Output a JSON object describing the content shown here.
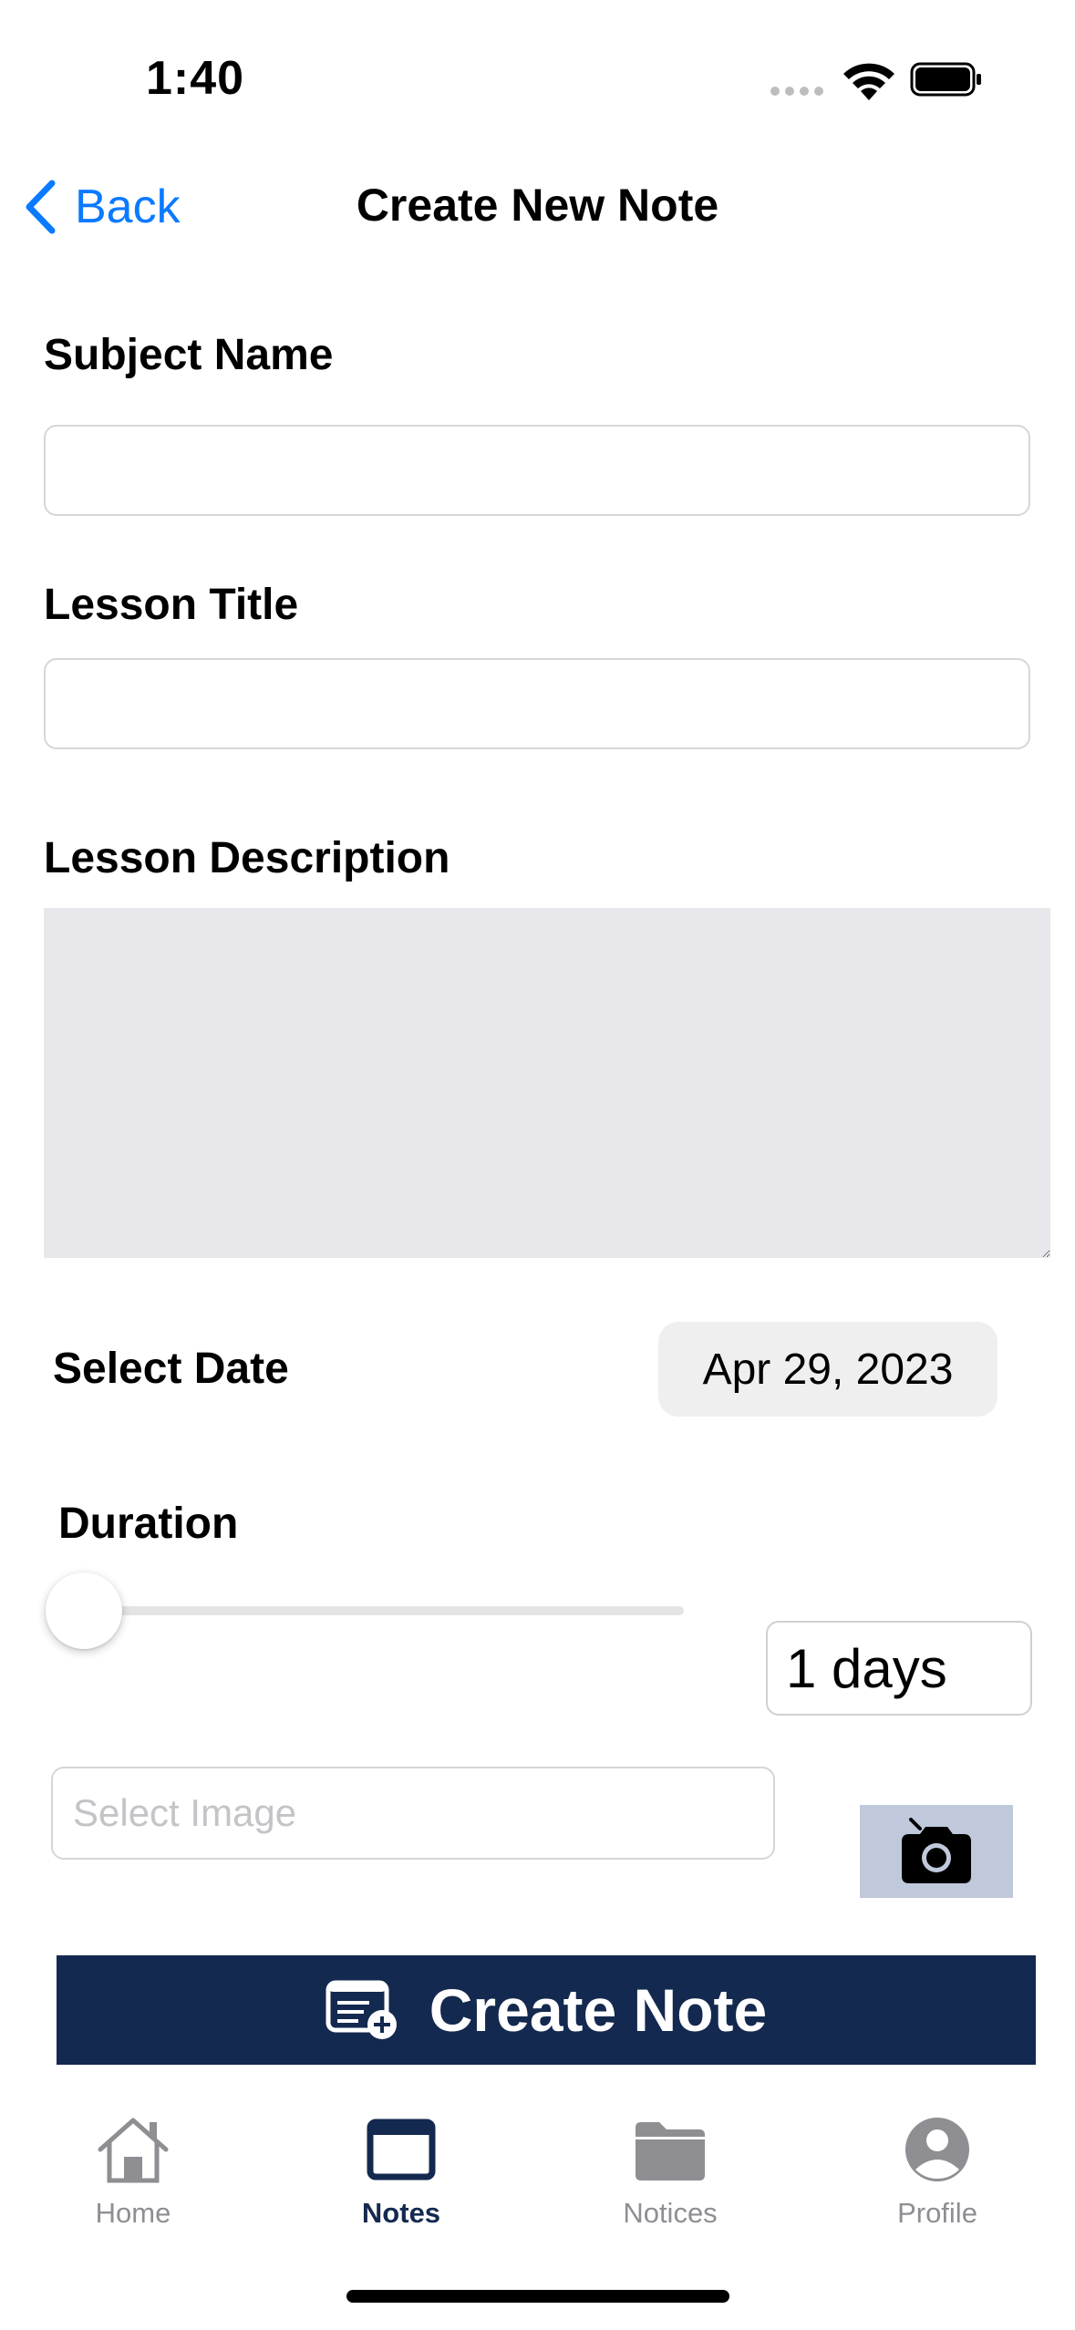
{
  "status_bar": {
    "time": "1:40"
  },
  "nav": {
    "back_label": "Back",
    "title": "Create New Note"
  },
  "form": {
    "subject_label": "Subject Name",
    "subject_value": "",
    "lesson_title_label": "Lesson Title",
    "lesson_title_value": "",
    "description_label": "Lesson Description",
    "description_value": "",
    "date_label": "Select Date",
    "date_value": "Apr 29, 2023",
    "duration_label": "Duration",
    "duration_value": "1 days",
    "duration_slider_fraction": 0.0,
    "image_placeholder": "Select Image",
    "create_label": "Create Note"
  },
  "tabs": [
    {
      "label": "Home",
      "icon": "house-icon",
      "active": false
    },
    {
      "label": "Notes",
      "icon": "window-icon",
      "active": true
    },
    {
      "label": "Notices",
      "icon": "folder-icon",
      "active": false
    },
    {
      "label": "Profile",
      "icon": "person-circle-icon",
      "active": false
    }
  ],
  "colors": {
    "accent": "#0a7aff",
    "primary": "#14294f",
    "camera_bg": "#c0c9dc",
    "inactive": "#8e8e93"
  }
}
